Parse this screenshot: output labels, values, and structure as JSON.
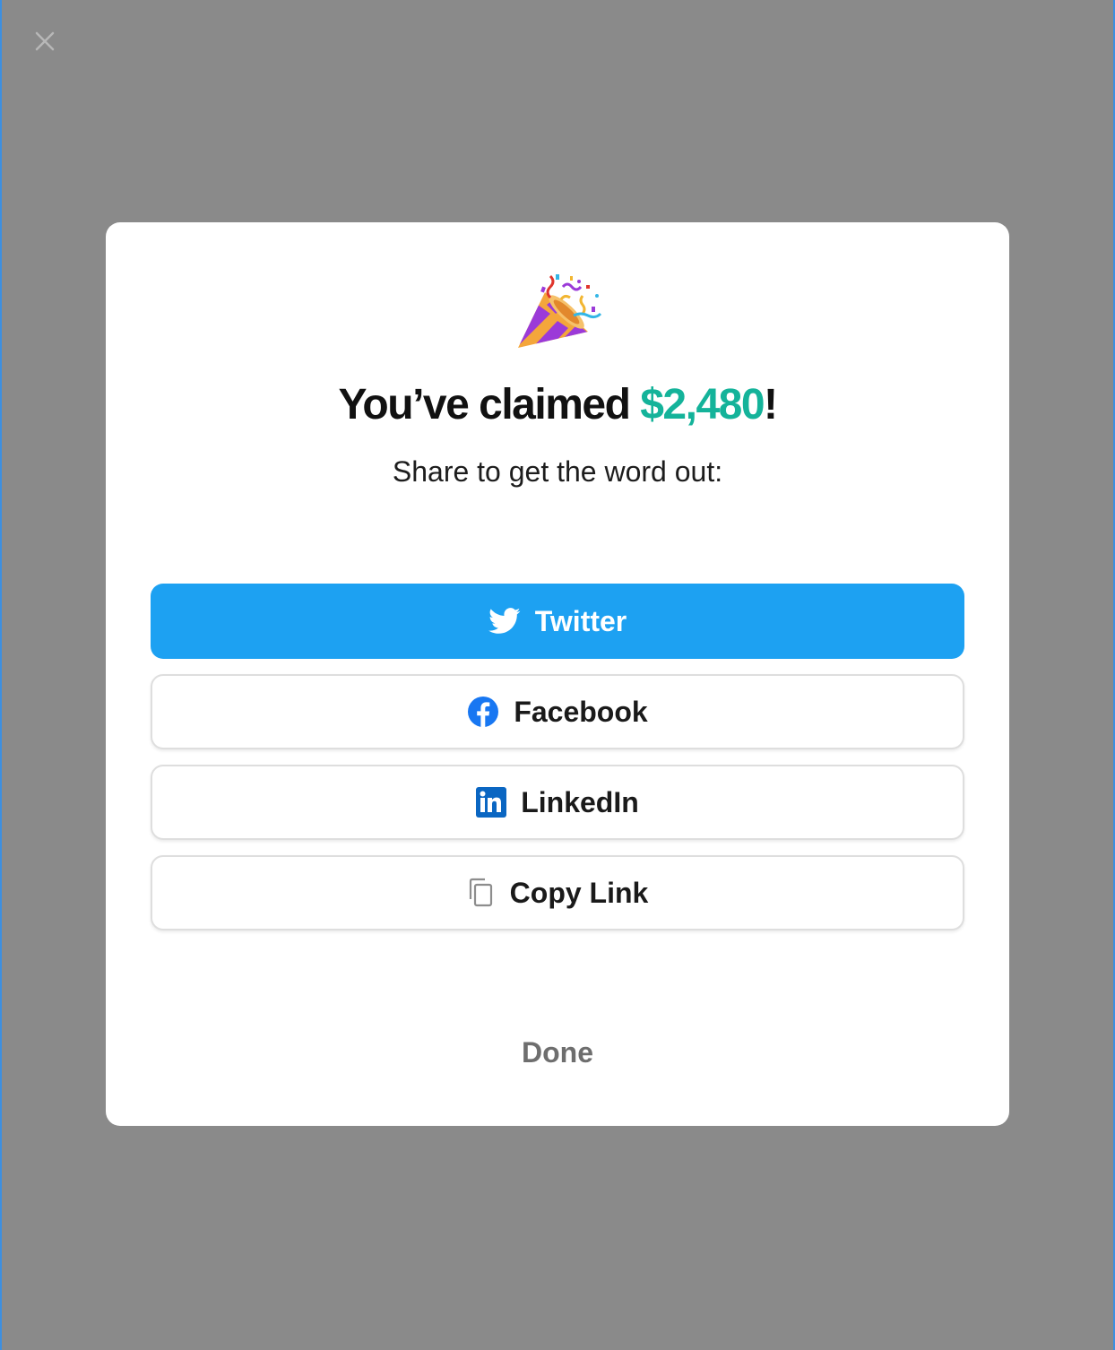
{
  "modal": {
    "headline_prefix": "You’ve claimed ",
    "amount": "$2,480",
    "headline_suffix": "!",
    "subtitle": "Share to get the word out:",
    "buttons": [
      {
        "label": "Twitter",
        "icon": "twitter-bird-icon"
      },
      {
        "label": "Facebook",
        "icon": "facebook-icon"
      },
      {
        "label": "LinkedIn",
        "icon": "linkedin-icon"
      },
      {
        "label": "Copy Link",
        "icon": "copy-icon"
      }
    ],
    "done_label": "Done",
    "emoji": "party-popper-icon"
  },
  "overlay": {
    "close_icon": "close-icon"
  },
  "colors": {
    "backdrop": "#8a8a8a",
    "accent_green": "#14b39a",
    "twitter_blue": "#1da1f2",
    "facebook_blue": "#1877f2",
    "linkedin_blue": "#0a66c2"
  }
}
